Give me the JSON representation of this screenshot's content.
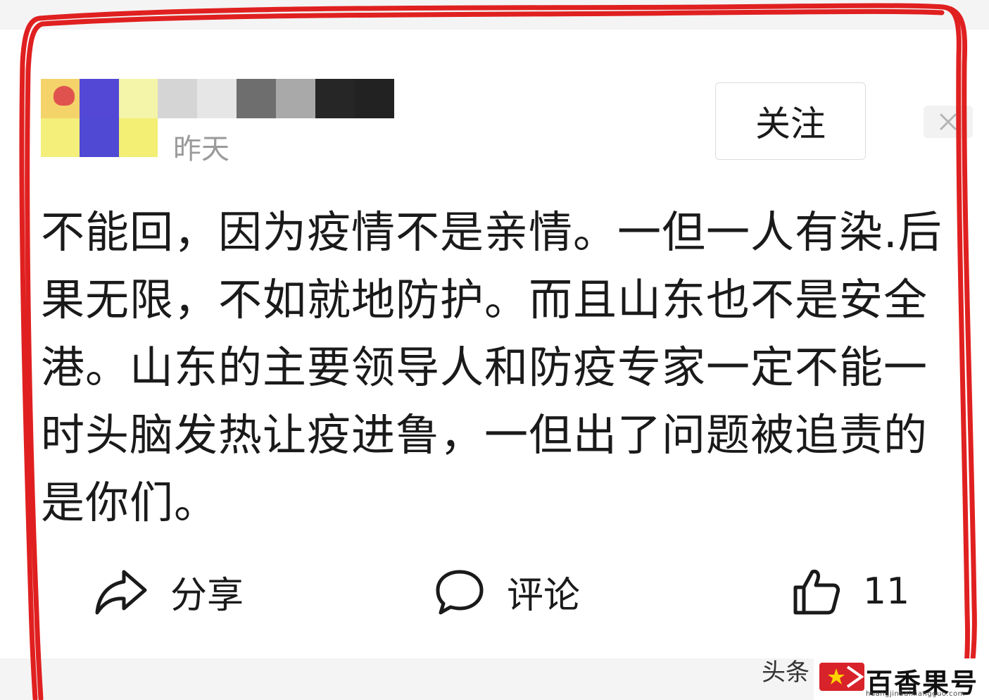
{
  "post": {
    "timestamp": "昨天",
    "follow_label": "关注",
    "content": "不能回，因为疫情不是亲情。一但一人有染.后果无限，不如就地防护。而且山东也不是安全港。山东的主要领导人和防疫专家一定不能一时头脑发热让疫进鲁，一但出了问题被追责的是你们。"
  },
  "actions": {
    "share_label": "分享",
    "comment_label": "评论",
    "like_count": "11"
  },
  "watermark": {
    "platform": "头条",
    "brand": "百香果号",
    "url": "huangjinbaixiangguo.com"
  },
  "icons": {
    "share": "share-arrow-icon",
    "comment": "speech-bubble-icon",
    "like": "thumbs-up-icon",
    "dismiss": "close-icon"
  },
  "colors": {
    "annotation_frame": "#e02020",
    "timestamp": "#9a9a9a",
    "follow_border": "#dcdcdc",
    "watermark_red": "#d8232a"
  }
}
